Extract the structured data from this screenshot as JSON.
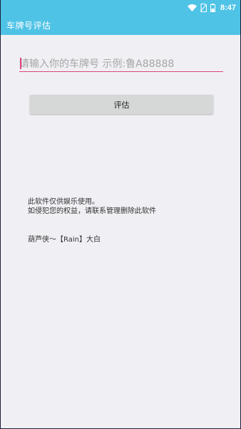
{
  "status_bar": {
    "time": "8:47",
    "icons": [
      "wifi-icon",
      "no-sim-icon",
      "battery-icon"
    ]
  },
  "app_bar": {
    "title": "车牌号评估"
  },
  "plate_input": {
    "value": "",
    "placeholder": "请输入你的车牌号 示例:鲁A88888"
  },
  "evaluate_button": {
    "label": "评估"
  },
  "disclaimer": {
    "line1": "此软件仅供娱乐使用。",
    "line2": "如侵犯您的权益，请联系管理删除此软件"
  },
  "author": {
    "text": "葫芦侠～【Rain】大白"
  },
  "colors": {
    "accent": "#4fc3e6",
    "input_underline": "#e0457b",
    "background": "#f0eff4",
    "button": "#d6d7d7"
  }
}
